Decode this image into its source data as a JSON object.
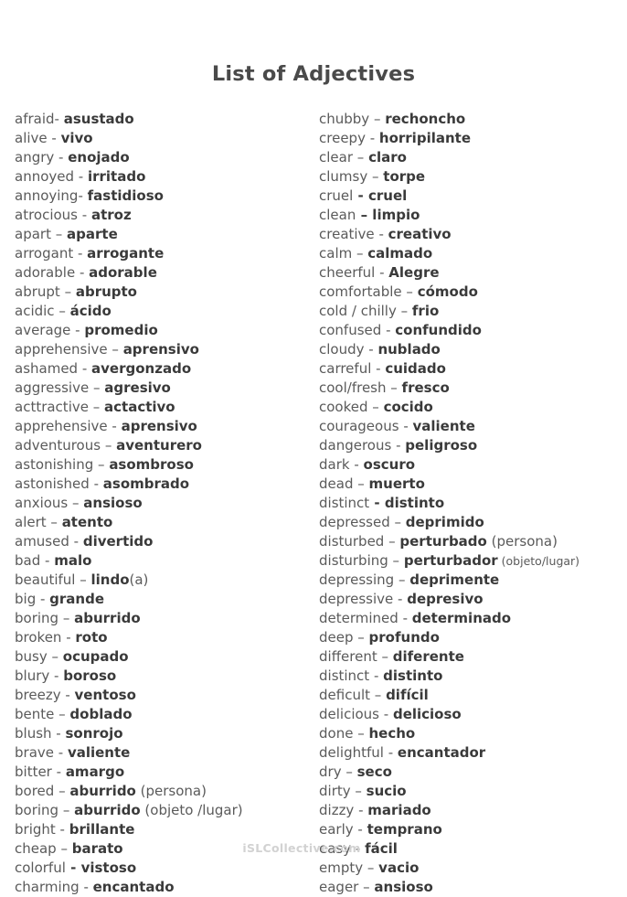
{
  "document": {
    "title": "List of Adjectives",
    "watermark": "iSLCollective.com"
  },
  "columns": {
    "left": [
      {
        "term": "afraid",
        "sep": "- ",
        "translation": "asustado"
      },
      {
        "term": "alive",
        "sep": " - ",
        "translation": "vivo"
      },
      {
        "term": "angry",
        "sep": " - ",
        "translation": "enojado"
      },
      {
        "term": "annoyed",
        "sep": " - ",
        "translation": "irritado"
      },
      {
        "term": "annoying",
        "sep": "- ",
        "translation": "fastidioso"
      },
      {
        "term": "atrocious",
        "sep": " - ",
        "translation": "atroz"
      },
      {
        "term": "apart",
        "sep": " – ",
        "translation": "aparte"
      },
      {
        "term": "arrogant",
        "sep": " - ",
        "translation": "arrogante"
      },
      {
        "term": "adorable",
        "sep": " - ",
        "translation": "adorable"
      },
      {
        "term": "abrupt",
        "sep": " – ",
        "translation": "abrupto"
      },
      {
        "term": "acidic",
        "sep": " – ",
        "translation": "ácido"
      },
      {
        "term": "average",
        "sep": " - ",
        "translation": "promedio"
      },
      {
        "term": "apprehensive",
        "sep": " – ",
        "translation": "aprensivo"
      },
      {
        "term": "ashamed",
        "sep": " - ",
        "translation": "avergonzado"
      },
      {
        "term": "aggressive",
        "sep": " – ",
        "translation": "agresivo"
      },
      {
        "term": "acttractive",
        "sep": " – ",
        "translation": "actactivo"
      },
      {
        "term": "apprehensive",
        "sep": " - ",
        "translation": "aprensivo"
      },
      {
        "term": "adventurous",
        "sep": " – ",
        "translation": "aventurero"
      },
      {
        "term": "astonishing",
        "sep": " – ",
        "translation": "asombroso"
      },
      {
        "term": "astonished",
        "sep": " - ",
        "translation": "asombrado"
      },
      {
        "term": "anxious",
        "sep": " – ",
        "translation": "ansioso"
      },
      {
        "term": "alert",
        "sep": " – ",
        "translation": "atento"
      },
      {
        "term": "amused",
        "sep": " - ",
        "translation": "divertido"
      },
      {
        "term": "bad",
        "sep": " - ",
        "translation": "malo"
      },
      {
        "term": "beautiful",
        "sep": " – ",
        "translation": "lindo",
        "note": "(a)"
      },
      {
        "term": "big",
        "sep": " - ",
        "translation": "grande"
      },
      {
        "term": "boring",
        "sep": " – ",
        "translation": "aburrido"
      },
      {
        "term": "broken",
        "sep": " - ",
        "translation": "roto"
      },
      {
        "term": "busy",
        "sep": " – ",
        "translation": "ocupado"
      },
      {
        "term": "blury",
        "sep": " - ",
        "translation": "boroso"
      },
      {
        "term": "breezy",
        "sep": " - ",
        "translation": "ventoso"
      },
      {
        "term": "bente",
        "sep": " – ",
        "translation": "doblado"
      },
      {
        "term": "blush",
        "sep": " - ",
        "translation": "sonrojo"
      },
      {
        "term": "brave",
        "sep": " - ",
        "translation": "valiente"
      },
      {
        "term": "bitter",
        "sep": " - ",
        "translation": "amargo"
      },
      {
        "term": "bored",
        "sep": " – ",
        "translation": "aburrido",
        "note": " (persona)"
      },
      {
        "term": "boring",
        "sep": " – ",
        "translation": "aburrido",
        "note": " (objeto /lugar)"
      },
      {
        "term": "bright",
        "sep": " - ",
        "translation": "brillante"
      },
      {
        "term": "cheap",
        "sep": " – ",
        "translation": "barato"
      },
      {
        "term": "colorful",
        "sep": " - ",
        "translation": "vistoso",
        "sep_bold": true
      },
      {
        "term": "charming",
        "sep": " - ",
        "translation": "encantado"
      }
    ],
    "right": [
      {
        "term": "chubby",
        "sep": " – ",
        "translation": "rechoncho"
      },
      {
        "term": "creepy",
        "sep": " - ",
        "translation": "horripilante"
      },
      {
        "term": "clear",
        "sep": " – ",
        "translation": "claro"
      },
      {
        "term": "clumsy",
        "sep": " – ",
        "translation": "torpe"
      },
      {
        "term": "cruel",
        "sep": " - ",
        "translation": "cruel",
        "sep_bold": true
      },
      {
        "term": "clean",
        "sep": " – ",
        "translation": "limpio",
        "sep_bold": true
      },
      {
        "term": "creative",
        "sep": " - ",
        "translation": "creativo"
      },
      {
        "term": "calm",
        "sep": " – ",
        "translation": "calmado"
      },
      {
        "term": "cheerful",
        "sep": " - ",
        "translation": "Alegre"
      },
      {
        "term": "comfortable",
        "sep": " – ",
        "translation": "cómodo"
      },
      {
        "term": "cold / chilly",
        "sep": " – ",
        "translation": "frio"
      },
      {
        "term": "confused",
        "sep": " - ",
        "translation": "confundido"
      },
      {
        "term": "cloudy",
        "sep": " - ",
        "translation": "nublado"
      },
      {
        "term": "carreful",
        "sep": " - ",
        "translation": "cuidado"
      },
      {
        "term": "cool/fresh",
        "sep": " – ",
        "translation": "fresco"
      },
      {
        "term": "cooked",
        "sep": " – ",
        "translation": "cocido"
      },
      {
        "term": "courageous",
        "sep": " - ",
        "translation": "valiente"
      },
      {
        "term": "dangerous",
        "sep": " - ",
        "translation": "peligroso"
      },
      {
        "term": "dark",
        "sep": " - ",
        "translation": "oscuro"
      },
      {
        "term": "dead",
        "sep": " – ",
        "translation": "muerto"
      },
      {
        "term": "distinct",
        "sep": " - ",
        "translation": "distinto",
        "sep_bold": true
      },
      {
        "term": "depressed",
        "sep": " – ",
        "translation": "deprimido"
      },
      {
        "term": "disturbed",
        "sep": " – ",
        "translation": "perturbado",
        "note": " (persona)"
      },
      {
        "term": "disturbing",
        "sep": " – ",
        "translation": "perturbador",
        "note": " (objeto/lugar)",
        "note_small": true
      },
      {
        "term": "depressing",
        "sep": " – ",
        "translation": "deprimente"
      },
      {
        "term": "depressive",
        "sep": " - ",
        "translation": "depresivo"
      },
      {
        "term": "determined",
        "sep": " - ",
        "translation": "determinado"
      },
      {
        "term": "deep",
        "sep": " – ",
        "translation": "profundo"
      },
      {
        "term": "different",
        "sep": " – ",
        "translation": "diferente"
      },
      {
        "term": "distinct",
        "sep": " - ",
        "translation": "distinto"
      },
      {
        "term": "deficult",
        "sep": " – ",
        "translation": "difícil"
      },
      {
        "term": "delicious",
        "sep": " - ",
        "translation": "delicioso"
      },
      {
        "term": "done",
        "sep": " – ",
        "translation": "hecho"
      },
      {
        "term": "delightful",
        "sep": " - ",
        "translation": "encantador"
      },
      {
        "term": "dry",
        "sep": " – ",
        "translation": "seco"
      },
      {
        "term": "dirty",
        "sep": " – ",
        "translation": "sucio"
      },
      {
        "term": "dizzy",
        "sep": " - ",
        "translation": "mariado"
      },
      {
        "term": "early",
        "sep": " - ",
        "translation": "temprano"
      },
      {
        "term": "easy",
        "sep": " - ",
        "translation": "fácil"
      },
      {
        "term": "empty",
        "sep": " – ",
        "translation": "vacio"
      },
      {
        "term": "eager",
        "sep": " – ",
        "translation": "ansioso"
      }
    ]
  }
}
